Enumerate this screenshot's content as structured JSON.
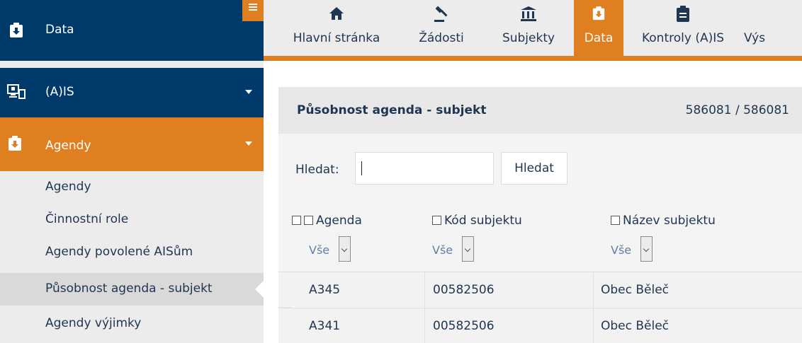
{
  "sidebar": {
    "brand": {
      "label": "Data",
      "icon": "clipboard-download-icon"
    },
    "sections": [
      {
        "label": "(A)IS",
        "icon": "monitor-network-icon"
      },
      {
        "label": "Agendy",
        "icon": "clipboard-download-icon"
      }
    ],
    "items": [
      {
        "label": "Agendy"
      },
      {
        "label": "Činnostní role"
      },
      {
        "label": "Agendy povolené AISům"
      },
      {
        "label": "Působnost agenda - subjekt",
        "active": true
      },
      {
        "label": "Agendy výjimky"
      }
    ]
  },
  "topnav": {
    "tabs": [
      {
        "label": "Hlavní stránka",
        "icon": "home-icon"
      },
      {
        "label": "Žádosti",
        "icon": "gavel-icon"
      },
      {
        "label": "Subjekty",
        "icon": "institution-icon"
      },
      {
        "label": "Data",
        "icon": "clipboard-download-icon",
        "active": true
      },
      {
        "label": "Kontroly (A)IS",
        "icon": "clipboard-check-icon"
      },
      {
        "label": "Výs",
        "icon": ""
      }
    ]
  },
  "panel": {
    "title": "Působnost agenda - subjekt",
    "count": "586081 / 586081"
  },
  "search": {
    "label": "Hledat:",
    "value": "",
    "button": "Hledat"
  },
  "table": {
    "columns": [
      {
        "label": "Agenda",
        "filter": "Vše"
      },
      {
        "label": "Kód subjektu",
        "filter": "Vše"
      },
      {
        "label": "Název subjektu",
        "filter": "Vše"
      }
    ],
    "rows": [
      {
        "agenda": "A345",
        "kod": "00582506",
        "nazev": "Obec Běleč"
      },
      {
        "agenda": "A341",
        "kod": "00582506",
        "nazev": "Obec Běleč"
      }
    ]
  },
  "colors": {
    "navy": "#003a6b",
    "orange": "#e07f1f",
    "text": "#1f3552"
  }
}
